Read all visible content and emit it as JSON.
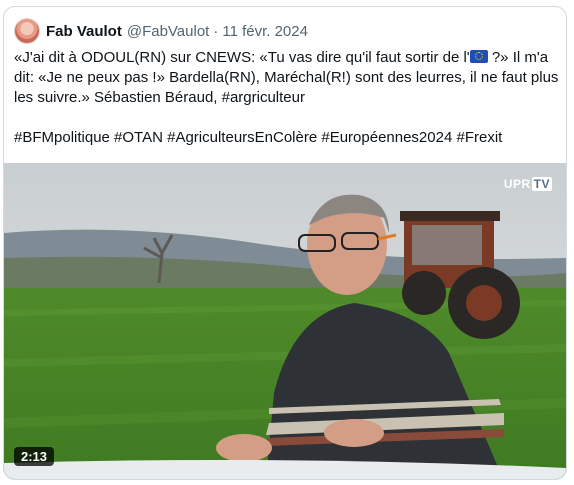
{
  "tweet": {
    "author_name": "Fab Vaulot",
    "author_handle": "@FabVaulot",
    "separator": "·",
    "date": "11 févr. 2024",
    "text_part1": "«J'ai dit à ODOUL(RN) sur CNEWS: «Tu vas dire qu'il faut sortir de l'",
    "flag_icon": "eu-flag-icon",
    "text_part2": " ?» Il m'a dit: «Je ne peux pas !» Bardella(RN), Maréchal(R!) sont des leurres, il ne faut plus les suivre.» Sébastien Béraud, #argriculteur\n\n#BFMpolitique #OTAN #AgriculteursEnColère #Européennes2024 #Frexit"
  },
  "video": {
    "watermark_text": "UPR",
    "watermark_box": "TV",
    "duration": "2:13"
  },
  "colors": {
    "text": "#0f1419",
    "secondary": "#536471",
    "border": "#cfd9de"
  }
}
